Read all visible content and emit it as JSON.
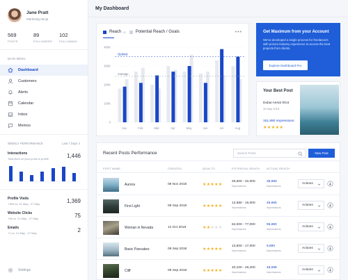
{
  "user": {
    "name": "Jane Pratt",
    "role": "Marketing Ninja"
  },
  "stats": [
    {
      "value": "569",
      "label": "POSTS"
    },
    {
      "value": "89",
      "label": "FOLLOWERS"
    },
    {
      "value": "102",
      "label": "FOLLOWING"
    }
  ],
  "menu": {
    "section_label": "MAIN MENU",
    "items": [
      {
        "label": "Dashboard",
        "icon": "home-icon",
        "active": true
      },
      {
        "label": "Customers",
        "icon": "user-icon"
      },
      {
        "label": "Alerts",
        "icon": "bell-icon"
      },
      {
        "label": "Calendar",
        "icon": "calendar-icon"
      },
      {
        "label": "Inbox",
        "icon": "inbox-icon"
      },
      {
        "label": "Memos",
        "icon": "memo-icon"
      }
    ]
  },
  "weekly": {
    "label": "WEEKLY PERFORMANCE",
    "period": "Last 7 Days",
    "interactions": {
      "title": "Interactions",
      "sub": "Total likes on your posts in profile",
      "value": "1,446",
      "bars": [
        0.85,
        0.55,
        0.35,
        0.55,
        0.75,
        0.8,
        0.45
      ]
    },
    "profile_visits": {
      "title": "Profile Visits",
      "sub": "+265 vs. 21 May - 27 May",
      "value": "1,369"
    },
    "website_clicks": {
      "title": "Website Clicks",
      "sub": "+48 vs. 21 May - 27 May",
      "value": "75"
    },
    "emails": {
      "title": "Emails",
      "sub": "+1 vs. 21 May - 27 May",
      "value": "2"
    }
  },
  "settings_label": "Settings",
  "page_title": "My Dashboard",
  "chart": {
    "tab1": "Reach",
    "vs": "vs",
    "tab2": "Potential Reach / Goals",
    "colors": {
      "reach": "#1a46c7",
      "potential": "#e6e9ee",
      "goals": "#d0d5de"
    }
  },
  "chart_data": {
    "type": "bar",
    "categories": [
      "Jan",
      "Feb",
      "Mar",
      "Apr",
      "May",
      "Jun",
      "Jul",
      "Aug"
    ],
    "series": [
      {
        "name": "Potential Reach",
        "values": [
          180,
          270,
          200,
          300,
          270,
          260,
          330,
          300
        ]
      },
      {
        "name": "Goals",
        "values": [
          230,
          290,
          180,
          280,
          360,
          270,
          250,
          230
        ]
      },
      {
        "name": "Reach",
        "values": [
          190,
          210,
          250,
          270,
          300,
          210,
          390,
          350
        ]
      }
    ],
    "yticks": [
      "0",
      "100K",
      "200K",
      "300K",
      "400K"
    ],
    "ylim": [
      0,
      400
    ],
    "annotations": [
      {
        "label": "Optimal",
        "y": 350
      },
      {
        "label": "Average",
        "y": 245
      }
    ]
  },
  "promo": {
    "title": "Get Maximum from your Account",
    "text": "We've developed a single process for freelancers with proven industry experience to access the best projects from clients.",
    "button": "Explore Dashboard Pro"
  },
  "best_post": {
    "title": "Your Best Post",
    "name": "Dubai Aerial Shot",
    "date": "30 May 2018",
    "impressions": "151,890 Impressions",
    "stars": 5
  },
  "posts": {
    "title": "Recent Posts Performance",
    "search_placeholder": "Search Posts",
    "new_button": "New Post",
    "headers": [
      "POST NAME",
      "CREATED",
      "QUALITY",
      "POTENTIAL REACH",
      "ACTUAL REACH"
    ],
    "rows": [
      {
        "name": "Aurora",
        "created": "08 Nov 2018",
        "stars": 5,
        "potential": "25,500 - 32,000",
        "impressions": "Impressions",
        "actual": "38,980",
        "actions": "Actions"
      },
      {
        "name": "First Light",
        "created": "09 Sep 2018",
        "stars": 5,
        "potential": "12,580 - 16,000",
        "impressions": "Impressions",
        "actual": "45,985",
        "actions": "Actions"
      },
      {
        "name": "Woman in Nevada",
        "created": "12 Oct 2018",
        "stars": 2,
        "potential": "62,000 - 77,000",
        "impressions": "Impressions",
        "actual": "96,880",
        "actions": "Actions"
      },
      {
        "name": "Basic Pancakes",
        "created": "09 Sep 2018",
        "stars": 5,
        "potential": "13,600 - 17,000",
        "impressions": "Impressions",
        "actual": "9,890",
        "actions": "Actions"
      },
      {
        "name": "Cliff",
        "created": "09 Sep 2018",
        "stars": 5,
        "potential": "40,100 - 46,200",
        "impressions": "Impressions",
        "actual": "48,698",
        "actions": "Actions"
      }
    ]
  }
}
